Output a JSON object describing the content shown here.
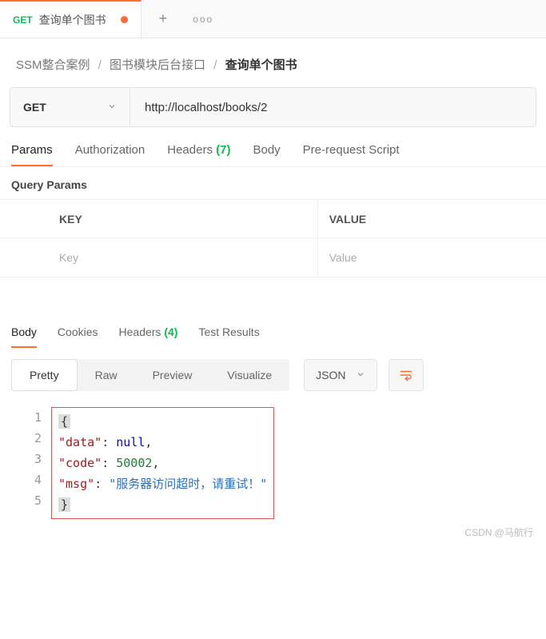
{
  "tab": {
    "method": "GET",
    "title": "查询单个图书",
    "unsaved": true
  },
  "tab_actions": {
    "plus": "+",
    "more": "ooo"
  },
  "breadcrumb": {
    "a": "SSM整合案例",
    "b": "图书模块后台接口",
    "c": "查询单个图书",
    "sep": "/"
  },
  "request": {
    "method": "GET",
    "url": "http://localhost/books/2"
  },
  "req_tabs": {
    "params": "Params",
    "auth": "Authorization",
    "headers": "Headers",
    "headers_count": "(7)",
    "body": "Body",
    "prereq": "Pre-request Script"
  },
  "query_params": {
    "title": "Query Params",
    "header_key": "KEY",
    "header_value": "VALUE",
    "ph_key": "Key",
    "ph_value": "Value"
  },
  "resp_tabs": {
    "body": "Body",
    "cookies": "Cookies",
    "headers": "Headers",
    "headers_count": "(4)",
    "tests": "Test Results"
  },
  "view": {
    "pretty": "Pretty",
    "raw": "Raw",
    "preview": "Preview",
    "visualize": "Visualize",
    "format": "JSON"
  },
  "code_lines": {
    "l1": "1",
    "l2": "2",
    "l3": "3",
    "l4": "4",
    "l5": "5",
    "brace_open": "{",
    "brace_close": "}",
    "indent": "    ",
    "k_data": "\"data\"",
    "v_data": "null",
    "comma": ",",
    "k_code": "\"code\"",
    "v_code": "50002",
    "k_msg": "\"msg\"",
    "v_msg": "\"服务器访问超时，请重试！\"",
    "colon": ": "
  },
  "watermark": "CSDN @马航行"
}
